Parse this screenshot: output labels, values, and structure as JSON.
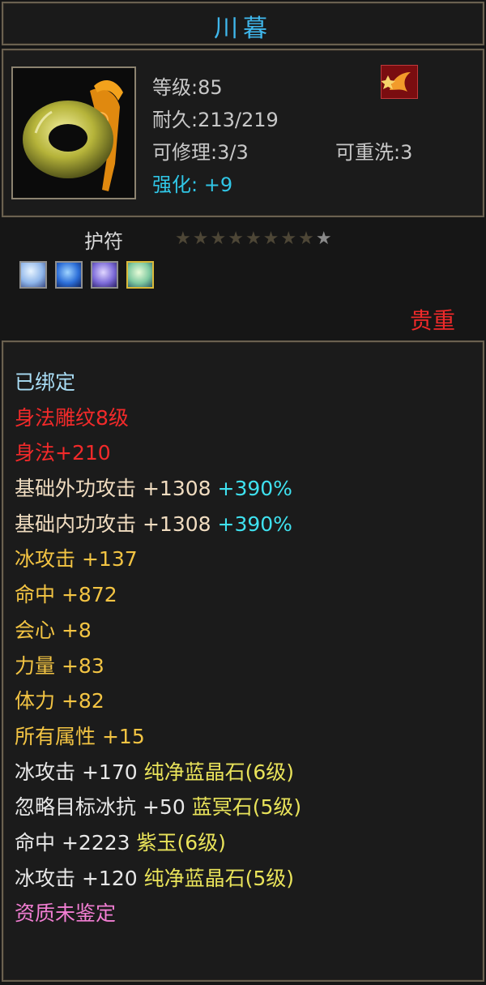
{
  "item_name": "川暮",
  "stats": {
    "level": "等级:85",
    "durability": "耐久:213/219",
    "repair": "可修理:3/3",
    "rewash": "可重洗:3",
    "enhance": "强化: +9"
  },
  "item_type": "护符",
  "stars_total": 9,
  "stars_lit": 1,
  "gem_icons": [
    "gem-white-blue-icon",
    "gem-blue-crystal-icon",
    "gem-purple-icon",
    "gem-green-icon"
  ],
  "rarity": "贵重",
  "attributes": {
    "bound": "已绑定",
    "carving": "身法雕纹8级",
    "agility": "身法+210",
    "base_ext": {
      "label": "基础外功攻击",
      "value": "+1308",
      "pct": "+390%"
    },
    "base_int": {
      "label": "基础内功攻击",
      "value": "+1308",
      "pct": "+390%"
    },
    "ice_attack": {
      "label": "冰攻击",
      "value": "+137"
    },
    "hit": {
      "label": "命中",
      "value": "+872"
    },
    "crit": {
      "label": "会心",
      "value": "+8"
    },
    "strength": {
      "label": "力量",
      "value": "+83"
    },
    "stamina": {
      "label": "体力",
      "value": "+82"
    },
    "all_attr": {
      "label": "所有属性",
      "value": "+15"
    },
    "gem1": {
      "label": "冰攻击",
      "value": "+170",
      "gem": "纯净蓝晶石(6级)"
    },
    "gem2": {
      "label": "忽略目标冰抗",
      "value": "+50",
      "gem": "蓝冥石(5级)"
    },
    "gem3": {
      "label": "命中",
      "value": "+2223",
      "gem": "紫玉(6级)"
    },
    "gem4": {
      "label": "冰攻击",
      "value": "+120",
      "gem": "纯净蓝晶石(5级)"
    },
    "quality": "资质未鉴定"
  },
  "colors": {
    "title": "#3fb7ec",
    "enhance": "#30c6e6",
    "rarity": "#ef2a2a",
    "gold_stat": "#f3c443",
    "percent": "#3fe1ef",
    "quality": "#f27ed3"
  }
}
